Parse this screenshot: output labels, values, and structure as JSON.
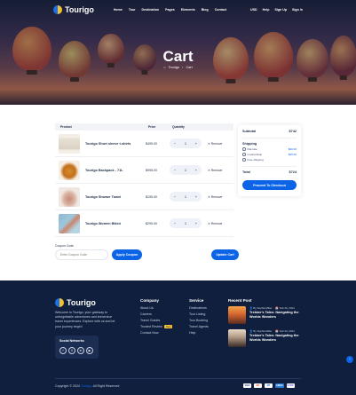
{
  "nav": {
    "brand": "Tourigo",
    "menu": [
      "Home",
      "Tour",
      "Destination",
      "Pages",
      "Elements",
      "Blog",
      "Contact"
    ],
    "currency": "USD",
    "help": "Help",
    "signup": "Sign Up",
    "signin": "Sign In"
  },
  "hero": {
    "title": "Cart",
    "breadcrumb": [
      "Tourigo",
      "Cart"
    ]
  },
  "cart": {
    "headers": {
      "product": "Product",
      "price": "Price",
      "quantity": "Quantity"
    },
    "items": [
      {
        "name": "Tourigo Short sleeve t-shirts",
        "price": "$495.00",
        "qty": "1",
        "remove": "Remove"
      },
      {
        "name": "Tourigo Backpack - 71L",
        "price": "$995.00",
        "qty": "1",
        "remove": "Remove"
      },
      {
        "name": "Tourigo Shower Towel",
        "price": "$195.00",
        "qty": "1",
        "remove": "Remove"
      },
      {
        "name": "Tourigo Women Bikini",
        "price": "$295.00",
        "qty": "1",
        "remove": "Remove"
      }
    ],
    "coupon_label": "Coupon Code",
    "coupon_placeholder": "Enter Coupon Code",
    "apply_label": "Apply Coupon",
    "update_label": "Update Cart"
  },
  "summary": {
    "subtotal_label": "Subtotal",
    "subtotal_value": "$742",
    "shipping_label": "Shipping",
    "options": [
      {
        "label": "Flat rate",
        "value": "$20.00"
      },
      {
        "label": "Local pickup",
        "value": "$25.00"
      },
      {
        "label": "Free shipping",
        "value": ""
      }
    ],
    "total_label": "Total",
    "total_value": "$724",
    "checkout_label": "Proceed To Checkout"
  },
  "footer": {
    "brand": "Tourigo",
    "about": "Welcome to Tourigo, your gateway to unforgettable adventures and immersive travel experiences. Explore with us and let your journey begin!",
    "social_title": "Social Networks",
    "social": [
      "f",
      "X",
      "in",
      "▶"
    ],
    "company_title": "Company",
    "company": [
      "About Us",
      "Careers",
      "Travel Guides",
      "Trusted Review",
      "Contact Now"
    ],
    "new_badge": "New",
    "service_title": "Service",
    "service": [
      "Destinations",
      "Tour Listing",
      "Tour Booking",
      "Travel Agents",
      "Help"
    ],
    "recent_title": "Recent Post",
    "posts": [
      {
        "author": "By Sophia Miller",
        "date": "Feb 20, 2024",
        "title": "Trekker's Tales: Navigating the Worlds Wonders"
      },
      {
        "author": "By Sophia Miller",
        "date": "Feb 20, 2024",
        "title": "Trekker's Tales: Navigating the Worlds Wonders"
      }
    ],
    "copyright_prefix": "Copyright © 2024",
    "copyright_brand": "Tourigo",
    "copyright_suffix": ". All Right Reserved",
    "payments": [
      "VISA",
      "MC",
      "PP",
      "AMEX",
      "STRP"
    ]
  },
  "colors": {
    "accent": "#0b63e6",
    "footer_bg": "#0f1f3d",
    "badge": "#f5c02e"
  }
}
